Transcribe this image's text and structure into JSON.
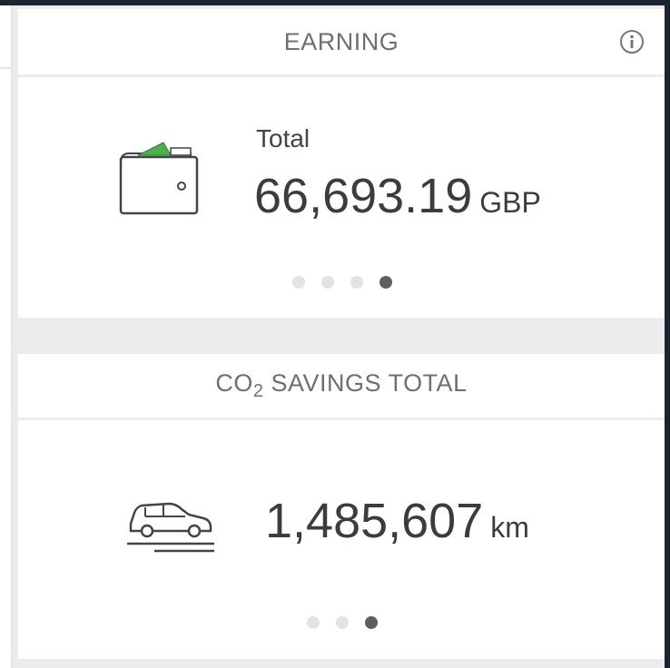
{
  "earning_card": {
    "title": "EARNING",
    "info_icon": "info-icon",
    "wallet_icon": "wallet-icon",
    "label": "Total",
    "value": "66,693.19",
    "unit": "GBP",
    "pagination": {
      "count": 4,
      "active_index": 3
    },
    "accent_color": "#4caf50"
  },
  "co2_card": {
    "title_prefix": "CO",
    "title_sub": "2",
    "title_suffix": " SAVINGS TOTAL",
    "car_icon": "car-icon",
    "value": "1,485,607",
    "unit": "km",
    "pagination": {
      "count": 3,
      "active_index": 2
    }
  }
}
